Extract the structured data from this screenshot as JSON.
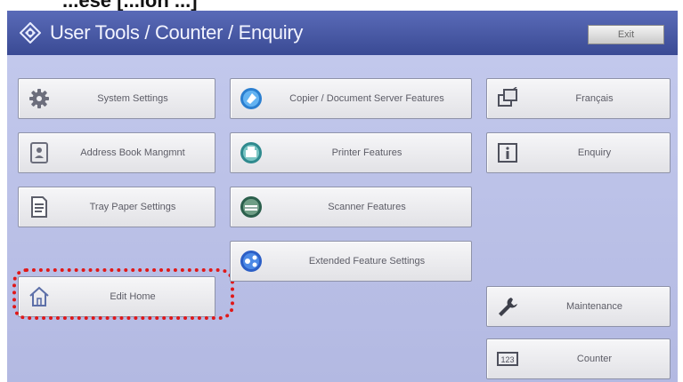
{
  "header_fragment": "...ese [...ion ...]",
  "titlebar": {
    "title": "User Tools / Counter / Enquiry",
    "exit_label": "Exit"
  },
  "colors": {
    "title_bar": "#4a5aa6",
    "panel": "#bcc2e8",
    "highlight": "#e01818"
  },
  "left_column": [
    {
      "label": "System Settings",
      "icon": "gear-icon"
    },
    {
      "label": "Address Book Mangmnt",
      "icon": "address-book-icon"
    },
    {
      "label": "Tray Paper Settings",
      "icon": "document-icon"
    },
    {
      "label": "Edit Home",
      "icon": "home-icon"
    }
  ],
  "middle_column": [
    {
      "label": "Copier / Document Server Features",
      "icon": "copier-icon"
    },
    {
      "label": "Printer Features",
      "icon": "printer-icon"
    },
    {
      "label": "Scanner Features",
      "icon": "scanner-icon"
    },
    {
      "label": "Extended Feature Settings",
      "icon": "extended-feature-icon"
    }
  ],
  "right_column": [
    {
      "label": "Français",
      "icon": "language-icon"
    },
    {
      "label": "Enquiry",
      "icon": "info-icon"
    },
    {
      "label": "Maintenance",
      "icon": "wrench-icon"
    },
    {
      "label": "Counter",
      "icon": "counter-icon"
    }
  ]
}
